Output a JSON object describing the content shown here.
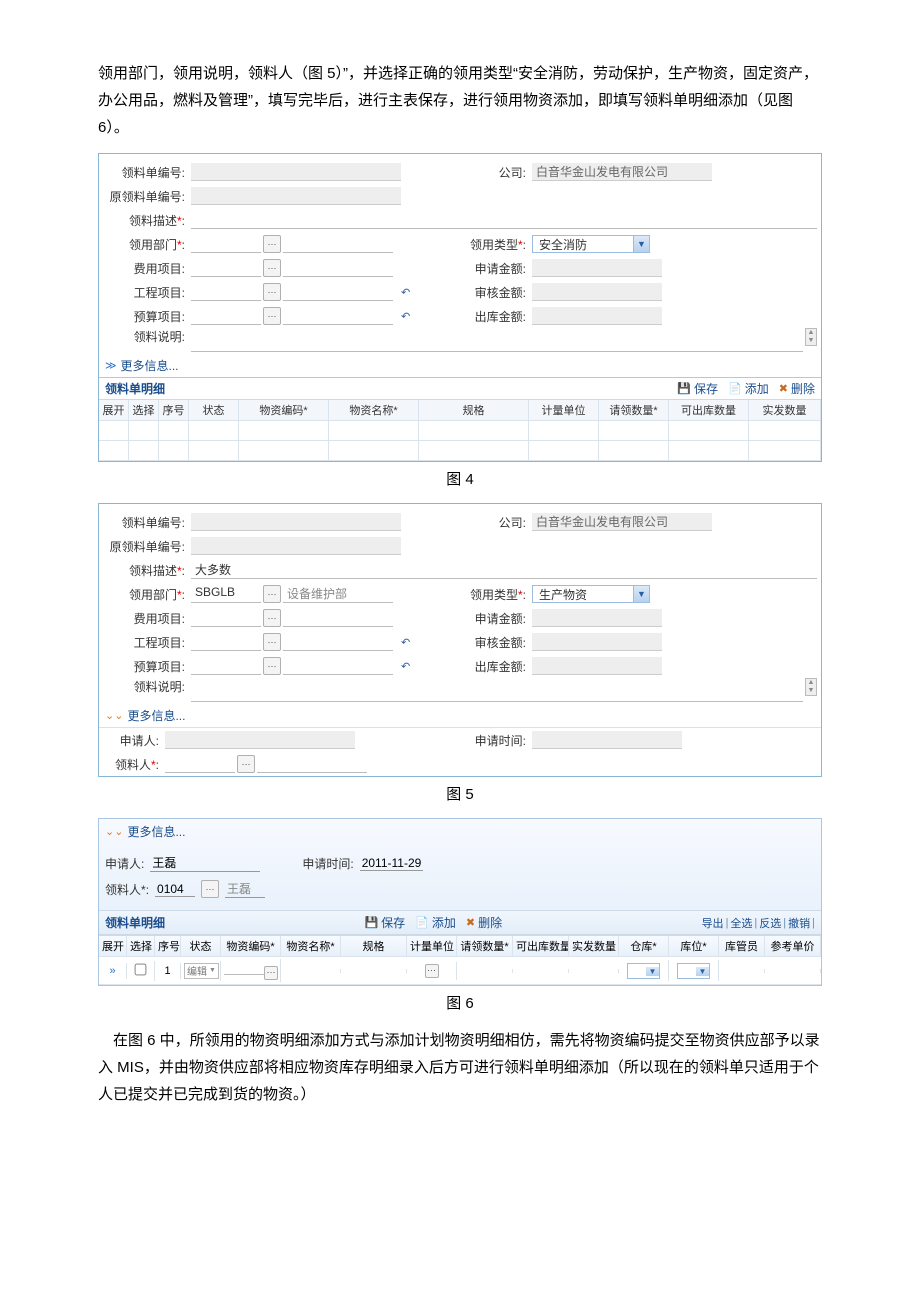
{
  "intro": "领用部门，领用说明，领料人（图 5）”，并选择正确的领用类型“安全消防，劳动保护，生产物资，固定资产，办公用品，燃料及管理”，填写完毕后，进行主表保存，进行领用物资添加，即填写领料单明细添加（见图 6）。",
  "labels": {
    "requisition_no": "领料单编号:",
    "orig_requisition_no": "原领料单编号:",
    "req_desc": "领料描述",
    "use_dept": "领用部门",
    "fee_item": "费用项目:",
    "project_item": "工程项目:",
    "budget_item": "预算项目:",
    "req_note": "领料说明:",
    "company": "公司:",
    "use_type": "领用类型",
    "apply_amount": "申请金额:",
    "audit_amount": "审核金额:",
    "out_amount": "出库金额:",
    "more": "更多信息...",
    "detail_title": "领料单明细",
    "applicant": "申请人:",
    "apply_time": "申请时间:",
    "picker": "领料人"
  },
  "actions": {
    "save": "保存",
    "add": "添加",
    "delete": "删除"
  },
  "fig4": {
    "company_value": "白音华金山发电有限公司",
    "use_type_value": "安全消防",
    "grid_headers": [
      "展开",
      "选择",
      "序号",
      "状态",
      "物资编码*",
      "物资名称*",
      "规格",
      "计量单位",
      "请领数量*",
      "可出库数量",
      "实发数量"
    ]
  },
  "fig5": {
    "company_value": "白音华金山发电有限公司",
    "req_desc_value": "大多数",
    "dept_code": "SBGLB",
    "dept_name": "设备维护部",
    "use_type_value": "生产物资"
  },
  "fig6": {
    "applicant_value": "王磊",
    "apply_time_value": "2011-11-29",
    "picker_code": "0104",
    "picker_name": "王磊",
    "right_links": [
      "导出",
      "全选",
      "反选",
      "撤销"
    ],
    "grid_headers": [
      "展开",
      "选择",
      "序号",
      "状态",
      "物资编码*",
      "物资名称*",
      "规格",
      "计量单位",
      "请领数量*",
      "可出库数量",
      "实发数量",
      "仓库*",
      "库位*",
      "库管员",
      "参考单价"
    ],
    "row_seq": "1",
    "row_status": "编辑"
  },
  "captions": {
    "fig4": "图 4",
    "fig5": "图 5",
    "fig6": "图 6"
  },
  "outro": "在图 6 中，所领用的物资明细添加方式与添加计划物资明细相仿，需先将物资编码提交至物资供应部予以录入 MIS，并由物资供应部将相应物资库存明细录入后方可进行领料单明细添加（所以现在的领料单只适用于个人已提交并已完成到货的物资。）"
}
